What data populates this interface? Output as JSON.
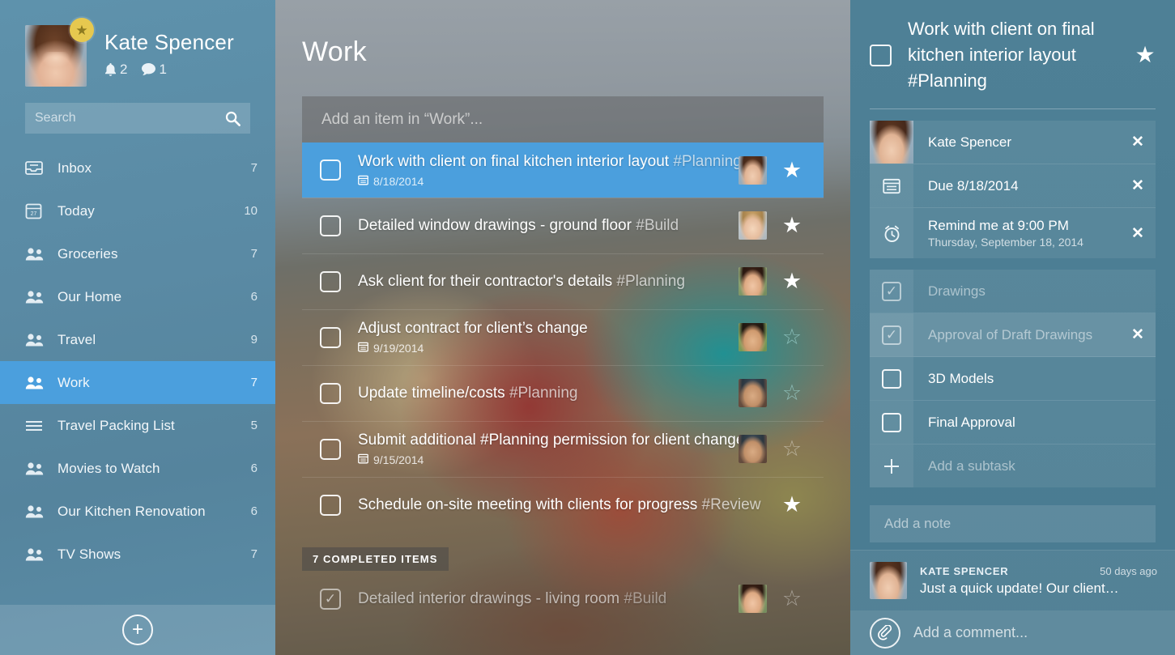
{
  "sidebar": {
    "user": {
      "name": "Kate Spencer",
      "notifications": "2",
      "messages": "1",
      "avatar_alt": "kate-avatar"
    },
    "search": {
      "placeholder": "Search",
      "value": ""
    },
    "items": [
      {
        "label": "Inbox",
        "count": "7",
        "icon": "inbox-icon"
      },
      {
        "label": "Today",
        "count": "10",
        "icon": "calendar-icon"
      },
      {
        "label": "Groceries",
        "count": "7",
        "icon": "people-icon"
      },
      {
        "label": "Our Home",
        "count": "6",
        "icon": "people-icon"
      },
      {
        "label": "Travel",
        "count": "9",
        "icon": "people-icon"
      },
      {
        "label": "Work",
        "count": "7",
        "icon": "people-icon"
      },
      {
        "label": "Travel Packing List",
        "count": "5",
        "icon": "list-icon"
      },
      {
        "label": "Movies to Watch",
        "count": "6",
        "icon": "people-icon"
      },
      {
        "label": "Our Kitchen Renovation",
        "count": "6",
        "icon": "people-icon"
      },
      {
        "label": "TV Shows",
        "count": "7",
        "icon": "people-icon"
      }
    ],
    "add_list_label": "+"
  },
  "main": {
    "title": "Work",
    "add_item_placeholder": "Add an item in “Work”...",
    "add_item_value": "",
    "tasks": [
      {
        "title": "Work with client on final kitchen interior layout",
        "tag": "#Planning",
        "date": "8/18/2014",
        "starred": true,
        "selected": true,
        "done": false,
        "avatar": "f1"
      },
      {
        "title": "Detailed window drawings - ground floor",
        "tag": "#Build",
        "date": "",
        "starred": true,
        "selected": false,
        "done": false,
        "avatar": "f2"
      },
      {
        "title": "Ask client for their contractor's details",
        "tag": "#Planning",
        "date": "",
        "starred": true,
        "selected": false,
        "done": false,
        "avatar": "f3"
      },
      {
        "title": "Adjust contract for client’s change",
        "tag": "",
        "date": "9/19/2014",
        "starred": false,
        "selected": false,
        "done": false,
        "avatar": "f4"
      },
      {
        "title": "Update timeline/costs",
        "tag": "#Planning",
        "date": "",
        "starred": false,
        "selected": false,
        "done": false,
        "avatar": "f5"
      },
      {
        "title": "Submit additional #Planning permission for client change",
        "tag": "",
        "date": "9/15/2014",
        "starred": false,
        "selected": false,
        "done": false,
        "avatar": "f5"
      },
      {
        "title": "Schedule on-site meeting with clients for progress",
        "tag": "#Review",
        "date": "",
        "starred": true,
        "selected": false,
        "done": false,
        "avatar": ""
      }
    ],
    "completed_header": "7 COMPLETED ITEMS",
    "completed_tasks": [
      {
        "title": "Detailed interior drawings - living room",
        "tag": "#Build",
        "date": "",
        "starred": false,
        "selected": false,
        "done": true,
        "avatar": "f3"
      }
    ]
  },
  "detail": {
    "title": "Work with client on final kitchen interior layout #Planning",
    "checked": false,
    "starred": true,
    "meta_rows": [
      {
        "icon": "avatar-icon",
        "text": "Kate Spencer",
        "sub": "",
        "removable": true,
        "muted": false
      },
      {
        "icon": "calendar-icon",
        "text": "Due 8/18/2014",
        "sub": "",
        "removable": true,
        "muted": false
      },
      {
        "icon": "alarm-icon",
        "text": "Remind me at 9:00 PM",
        "sub": "Thursday, September 18, 2014",
        "removable": true,
        "muted": false
      }
    ],
    "subtasks": [
      {
        "label": "Drawings",
        "checked": true,
        "removable": false,
        "highlighted": false
      },
      {
        "label": "Approval of Draft Drawings",
        "checked": true,
        "removable": true,
        "highlighted": true
      },
      {
        "label": "3D Models",
        "checked": false,
        "removable": false,
        "highlighted": false
      },
      {
        "label": "Final Approval",
        "checked": false,
        "removable": false,
        "highlighted": false
      }
    ],
    "add_subtask_label": "Add a subtask",
    "add_note_label": "Add a note",
    "comment": {
      "author": "KATE SPENCER",
      "time": "50 days ago",
      "body": "Just a quick update! Our client…"
    },
    "add_comment_placeholder": "Add a comment..."
  },
  "colors": {
    "accent_blue": "#4b9fdd",
    "sidebar_blue": "#5b8aa6",
    "detail_teal": "#4d7f94",
    "star_badge_gold": "#e6c84f"
  }
}
